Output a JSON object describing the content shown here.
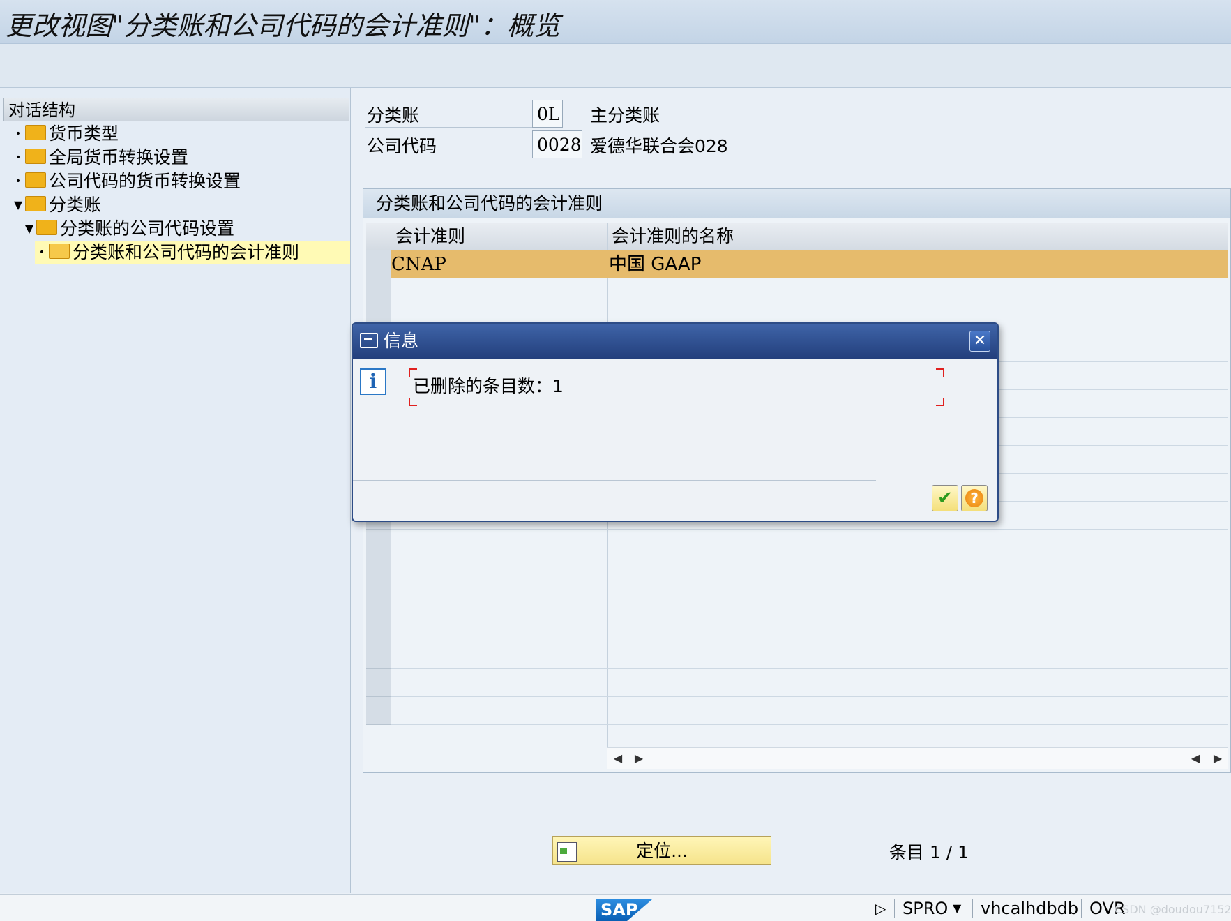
{
  "window": {
    "title": "更改视图\"分类账和公司代码的会计准则\"：概览"
  },
  "dialog_structure": {
    "title": "对话结构",
    "items": [
      {
        "label": "货币类型",
        "expanded": false
      },
      {
        "label": "全局货币转换设置",
        "expanded": false
      },
      {
        "label": "公司代码的货币转换设置",
        "expanded": false
      },
      {
        "label": "分类账",
        "expanded": true
      },
      {
        "label": "分类账的公司代码设置",
        "expanded": true
      },
      {
        "label": "分类账和公司代码的会计准则",
        "expanded": false,
        "selected": true
      }
    ]
  },
  "header_fields": {
    "ledger": {
      "label": "分类账",
      "value": "0L",
      "description": "主分类账"
    },
    "company_code": {
      "label": "公司代码",
      "value": "0028",
      "description": "爱德华联合会028"
    }
  },
  "table": {
    "title": "分类账和公司代码的会计准则",
    "columns": [
      "会计准则",
      "会计准则的名称"
    ],
    "rows": [
      {
        "rule": "CNAP",
        "name": "中国 GAAP",
        "selected": true
      }
    ]
  },
  "position_button": {
    "label": "定位..."
  },
  "entries_label": "条目 1 / 1",
  "dialog": {
    "title": "信息",
    "message": "已删除的条目数：1",
    "close_label": "✕",
    "ok_label": "✔",
    "help_label": "?"
  },
  "statusbar": {
    "logo": "SAP",
    "transaction": "SPRO",
    "system": "vhcalhdbdb",
    "mode": "OVR"
  },
  "watermark": "CSDN @doudou7152"
}
